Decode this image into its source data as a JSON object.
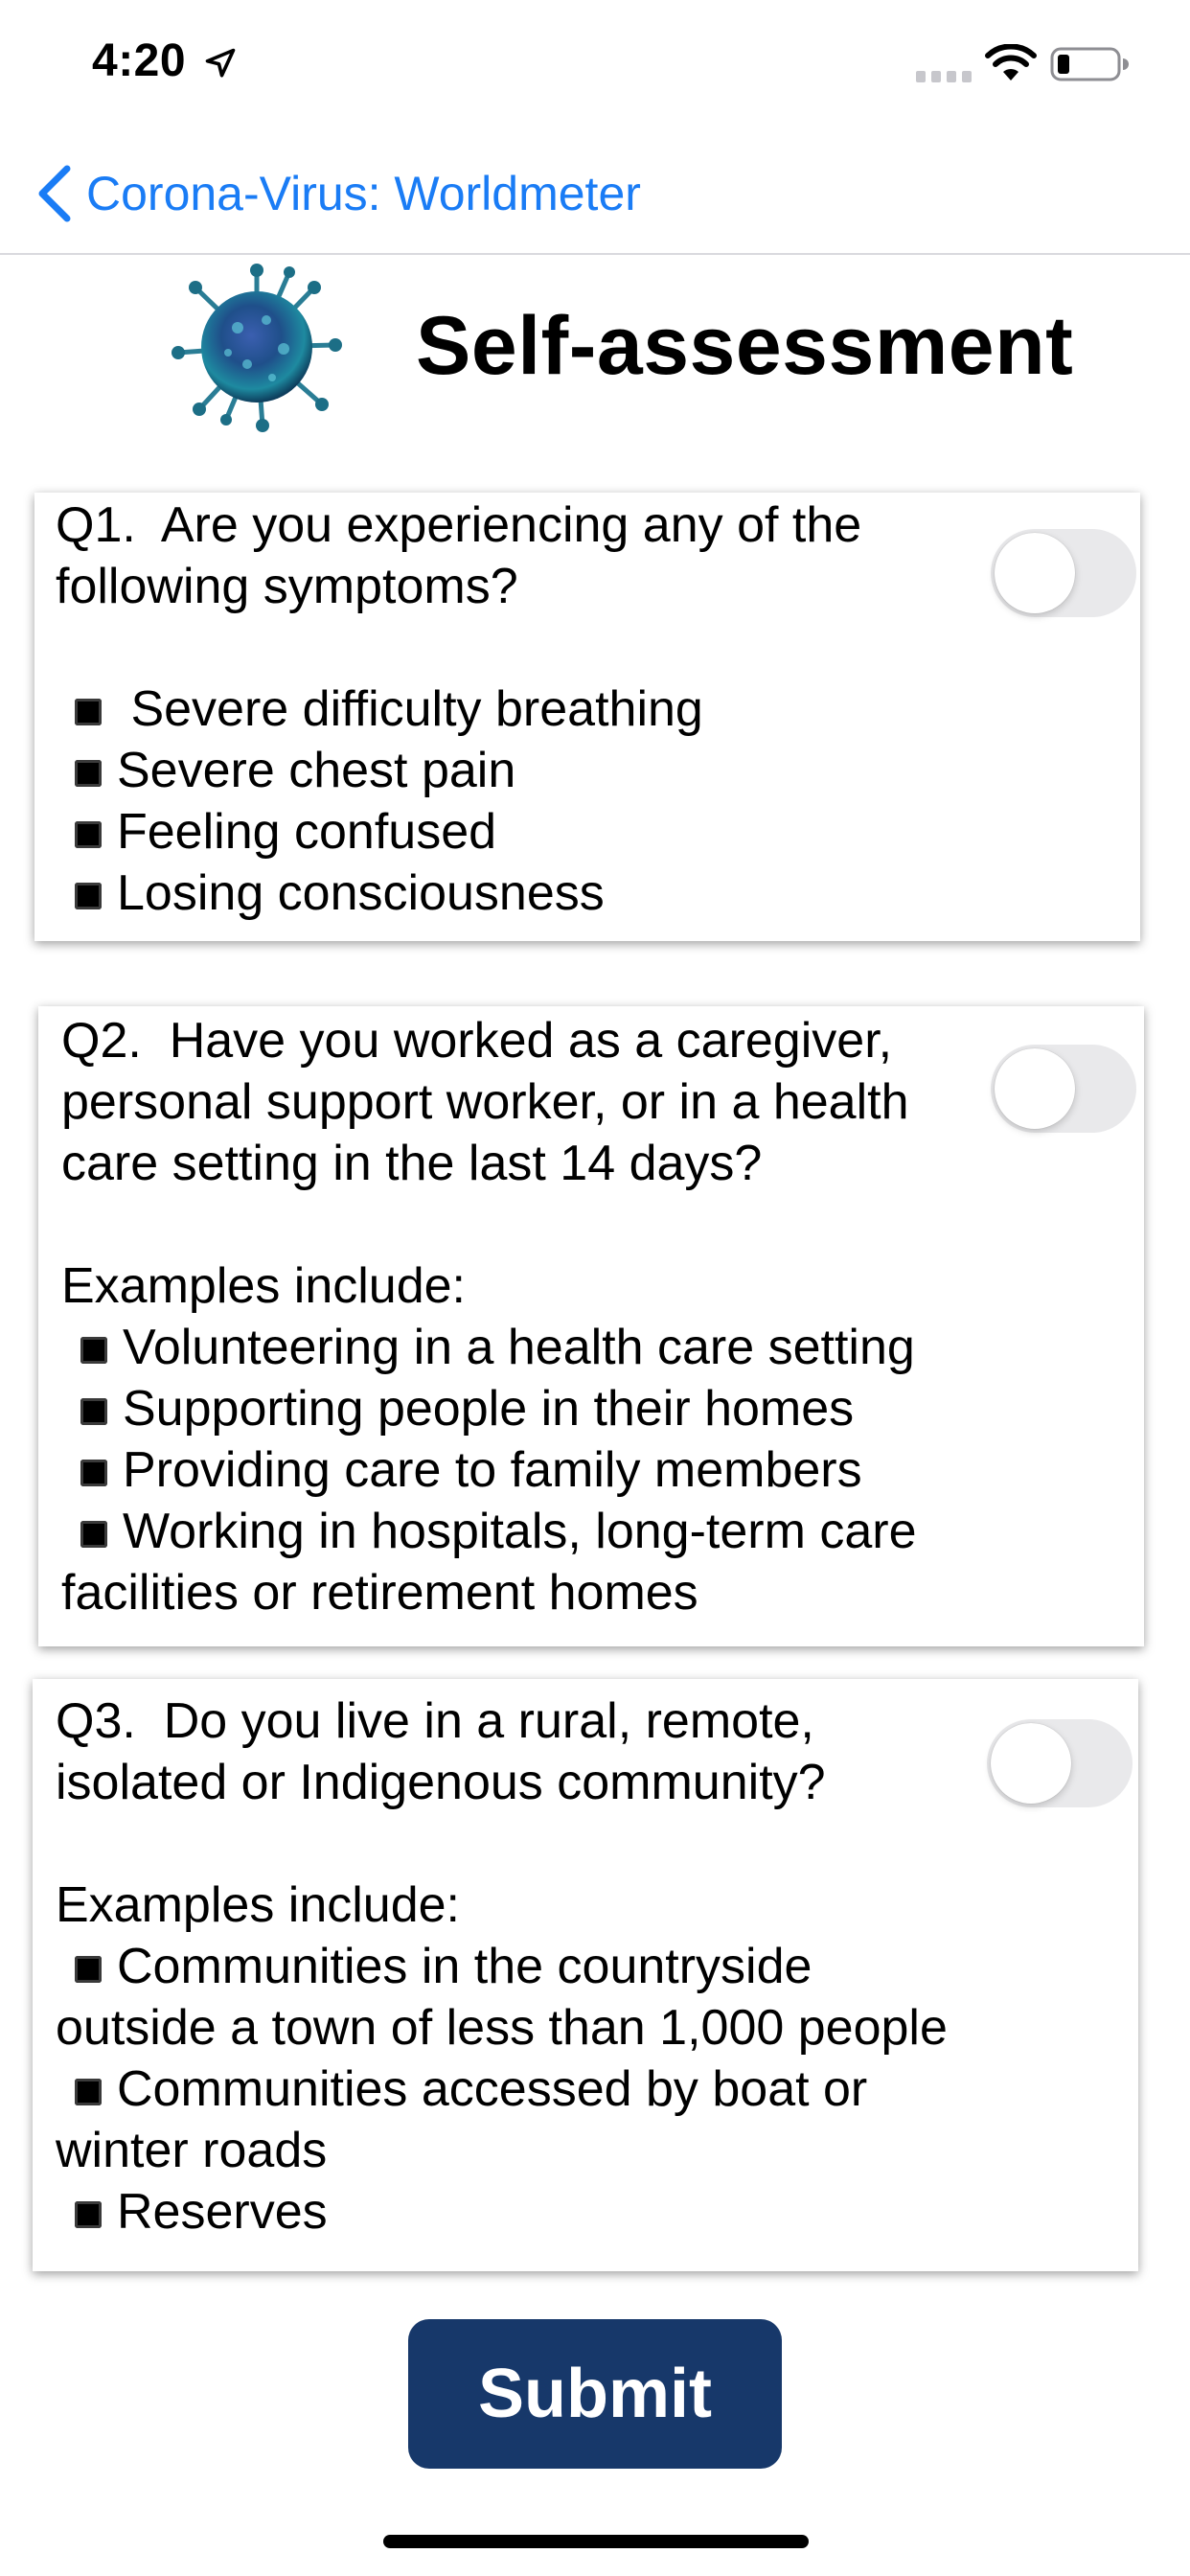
{
  "status_bar": {
    "time": "4:20",
    "icons": [
      "location-arrow-icon",
      "cellular-signal-icon",
      "wifi-icon",
      "battery-icon"
    ]
  },
  "nav": {
    "back_label": "Corona-Virus: Worldmeter",
    "accent_color": "#1a7cf5"
  },
  "header": {
    "title": "Self-assessment",
    "icon": "coronavirus-icon"
  },
  "questions": [
    {
      "lines": [
        {
          "text": "Q1.  Are you experiencing any of the",
          "bullet": false
        },
        {
          "text": "following symptoms?",
          "bullet": false
        },
        {
          "text": "",
          "bullet": false
        },
        {
          "text": " Severe difficulty breathing",
          "bullet": true
        },
        {
          "text": "Severe chest pain",
          "bullet": true
        },
        {
          "text": "Feeling confused",
          "bullet": true
        },
        {
          "text": "Losing consciousness",
          "bullet": true
        }
      ],
      "toggle_on": false
    },
    {
      "lines": [
        {
          "text": "Q2.  Have you worked as a caregiver,",
          "bullet": false
        },
        {
          "text": "personal support worker, or in a health",
          "bullet": false
        },
        {
          "text": "care setting in the last 14 days?",
          "bullet": false
        },
        {
          "text": "",
          "bullet": false
        },
        {
          "text": "Examples include:",
          "bullet": false
        },
        {
          "text": "Volunteering in a health care setting",
          "bullet": true
        },
        {
          "text": "Supporting people in their homes",
          "bullet": true
        },
        {
          "text": "Providing care to family members",
          "bullet": true
        },
        {
          "text": "Working in hospitals, long-term care",
          "bullet": true
        },
        {
          "text": "facilities or retirement homes",
          "bullet": false
        }
      ],
      "toggle_on": false
    },
    {
      "lines": [
        {
          "text": "Q3.  Do you live in a rural, remote,",
          "bullet": false
        },
        {
          "text": "isolated or Indigenous community?",
          "bullet": false
        },
        {
          "text": "",
          "bullet": false
        },
        {
          "text": "Examples include:",
          "bullet": false
        },
        {
          "text": "Communities in the countryside",
          "bullet": true
        },
        {
          "text": "outside a town of less than 1,000 people",
          "bullet": false
        },
        {
          "text": "Communities accessed by boat or",
          "bullet": true
        },
        {
          "text": "winter roads",
          "bullet": false
        },
        {
          "text": "Reserves",
          "bullet": true
        }
      ],
      "toggle_on": false
    }
  ],
  "submit": {
    "label": "Submit",
    "color": "#17386a"
  }
}
